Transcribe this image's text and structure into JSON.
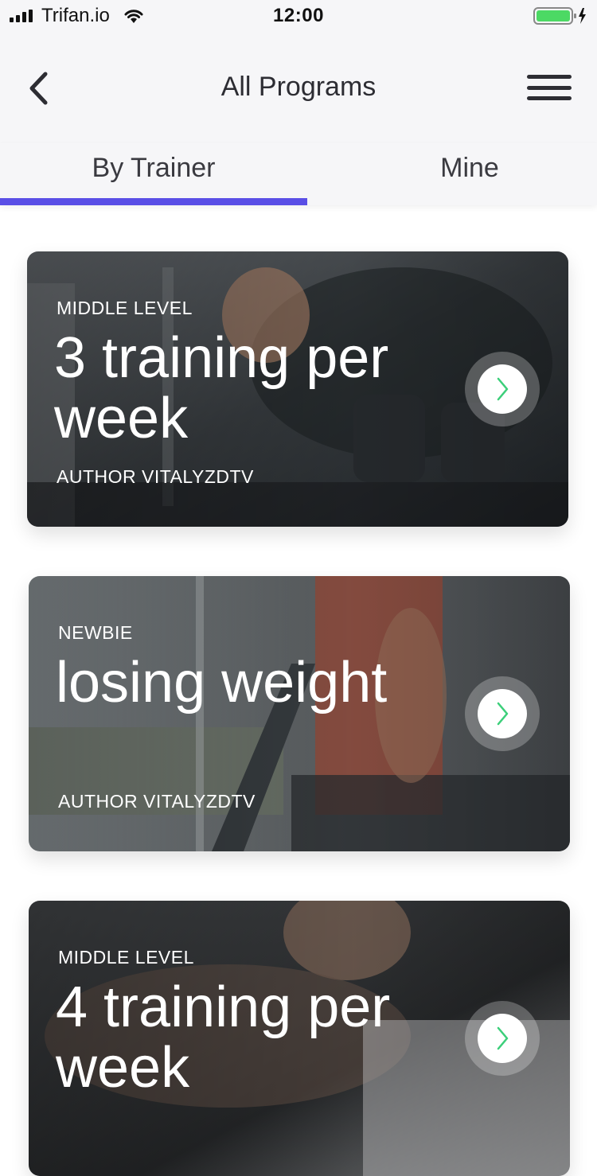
{
  "status_bar": {
    "carrier": "Trifan.io",
    "time": "12:00",
    "battery_color": "#4cd964"
  },
  "header": {
    "title": "All Programs",
    "back_icon": "chevron-left-icon",
    "menu_icon": "hamburger-menu-icon"
  },
  "tabs": [
    {
      "label": "By Trainer",
      "active": true
    },
    {
      "label": "Mine",
      "active": false
    }
  ],
  "accent_color": "#5a4fe6",
  "arrow_color": "#3ccf7a",
  "programs": [
    {
      "level": "MIDDLE LEVEL",
      "title": "3 training per week",
      "author": "AUTHOR VITALYZDTV",
      "image": "man-lifting-dumbbell"
    },
    {
      "level": "NEWBIE",
      "title": "losing weight",
      "author": "AUTHOR VITALYZDTV",
      "image": "woman-on-treadmill"
    },
    {
      "level": "MIDDLE LEVEL",
      "title": "4 training per week",
      "author": "",
      "image": "man-doing-pushups"
    }
  ]
}
